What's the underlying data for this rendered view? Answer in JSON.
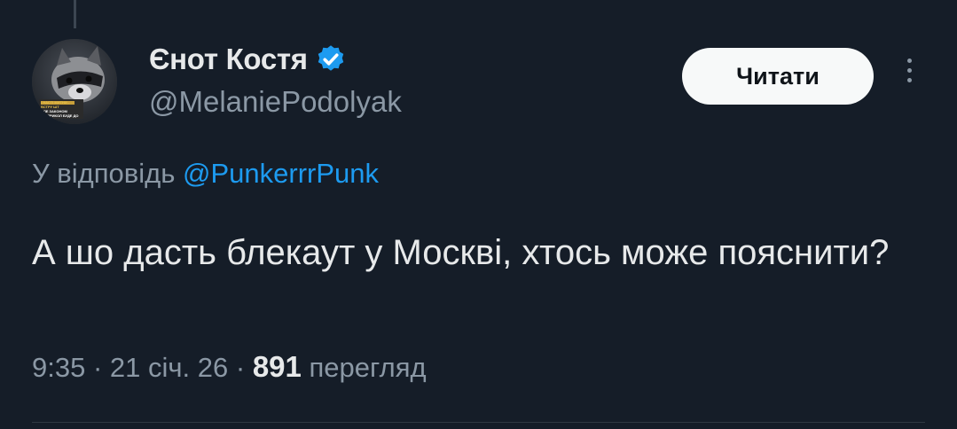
{
  "user": {
    "display_name": "Єнот Костя",
    "handle": "@MelaniePodolyak",
    "verified": true,
    "avatar_caption_lines": [
      "І НАСТІ МИТНИ - ВСТРУ ШТ",
      "АЛЕ ЗАКОНОМ",
      "БО ПРИКОЛ БУДЕ ДО ЛЮДЕЙ"
    ]
  },
  "follow_button_label": "Читати",
  "more_icon": "more-vertical-icon",
  "reply": {
    "prefix": "У відповідь",
    "mention": "@PunkerrrPunk"
  },
  "tweet": {
    "text": "А шо дасть блекаут у Москві, хтось може пояснити?"
  },
  "meta": {
    "time": "9:35",
    "date": "21 січ. 26",
    "views_count": "891",
    "views_label": "перегляд"
  },
  "colors": {
    "background": "#151d28",
    "accent": "#1d9bf0",
    "muted_text": "#8b98a5",
    "primary_text": "#e7e9ea"
  }
}
